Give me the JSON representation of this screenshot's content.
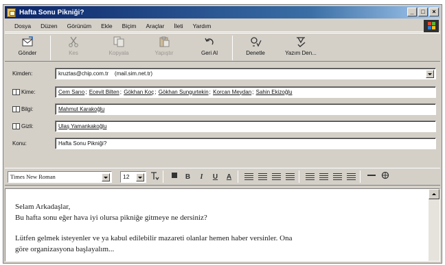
{
  "window": {
    "title": "Hafta Sonu Pikniği?",
    "controls": [
      "_",
      "□",
      "×"
    ]
  },
  "menu": [
    "Dosya",
    "Düzen",
    "Görünüm",
    "Ekle",
    "Biçim",
    "Araçlar",
    "İleti",
    "Yardım"
  ],
  "toolbar": [
    {
      "label": "Gönder",
      "icon": "send-icon",
      "enabled": true
    },
    {
      "label": "Kes",
      "icon": "cut-icon",
      "enabled": false
    },
    {
      "label": "Kopyala",
      "icon": "copy-icon",
      "enabled": false
    },
    {
      "label": "Yapıştır",
      "icon": "paste-icon",
      "enabled": false
    },
    {
      "label": "Geri Al",
      "icon": "undo-icon",
      "enabled": true
    },
    {
      "label": "Denetle",
      "icon": "check-names-icon",
      "enabled": true
    },
    {
      "label": "Yazım Den...",
      "icon": "spelling-icon",
      "enabled": true
    }
  ],
  "fields": {
    "from_label": "Kimden:",
    "from_value": "kruztas@chip.com.tr    (mail.sim.net.tr)",
    "to_label": "Kime:",
    "to_recipients": [
      "Cem Sarıo",
      "Ecevit Bilten",
      "Gökhan Koç",
      "Gökhan Sungurtekin",
      "Korcan Meydan",
      "Sahin Ekizoğlu"
    ],
    "cc_label": "Bilgi:",
    "cc_recipients": [
      "Mahmut Karakoğlu"
    ],
    "bcc_label": "Gizli:",
    "bcc_recipients": [
      "Ulaş Yamankakoğlu"
    ],
    "subject_label": "Konu:",
    "subject_value": "Hafta Sonu Pikniği?"
  },
  "format": {
    "font": "Times New Roman",
    "size": "12",
    "buttons": {
      "bold": "B",
      "italic": "I",
      "underline": "U",
      "font_color": "A"
    }
  },
  "message": {
    "line1": "Selam Arkadaşlar,",
    "line2": "Bu hafta sonu eğer hava iyi olursa pikniğe gitmeye ne dersiniz?",
    "line3": "Lütfen gelmek isteyenler ve ya kabul edilebilir mazareti olanlar hemen haber versinler. Ona",
    "line4": "göre organizasyona başlayalım..."
  }
}
